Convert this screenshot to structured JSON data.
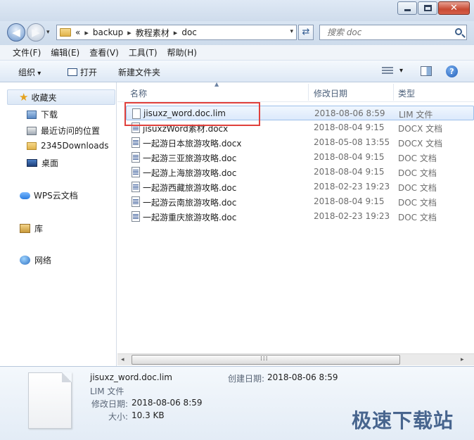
{
  "window": {
    "minimize_icon": "minimize-icon",
    "maximize_icon": "maximize-icon",
    "close_label": "✕"
  },
  "address": {
    "overflow": "«",
    "crumbs": [
      "backup",
      "教程素材",
      "doc"
    ],
    "separator": "▸",
    "refresh_glyph": "⇄",
    "search_placeholder": "搜索 doc"
  },
  "menu": [
    "文件(F)",
    "编辑(E)",
    "查看(V)",
    "工具(T)",
    "帮助(H)"
  ],
  "toolbar": {
    "organize": "组织",
    "open": "打开",
    "new_folder": "新建文件夹",
    "help_glyph": "?"
  },
  "sidebar": {
    "favorites": "收藏夹",
    "fav_items": [
      "下载",
      "最近访问的位置",
      "2345Downloads",
      "桌面"
    ],
    "wps_cloud": "WPS云文档",
    "library": "库",
    "network": "网络"
  },
  "columns": {
    "name": "名称",
    "date": "修改日期",
    "type": "类型"
  },
  "files": [
    {
      "name": "jisuxz_word.doc.lim",
      "date": "2018-08-06 8:59",
      "type": "LIM 文件",
      "icon": "blank-file-icon",
      "selected": true
    },
    {
      "name": "jisuxzWord素材.docx",
      "date": "2018-08-04 9:15",
      "type": "DOCX 文档",
      "icon": "word-doc-icon"
    },
    {
      "name": "一起游日本旅游攻略.docx",
      "date": "2018-05-08 13:55",
      "type": "DOCX 文档",
      "icon": "word-doc-icon"
    },
    {
      "name": "一起游三亚旅游攻略.doc",
      "date": "2018-08-04 9:15",
      "type": "DOC 文档",
      "icon": "word-doc-icon"
    },
    {
      "name": "一起游上海旅游攻略.doc",
      "date": "2018-08-04 9:15",
      "type": "DOC 文档",
      "icon": "word-doc-icon"
    },
    {
      "name": "一起游西藏旅游攻略.doc",
      "date": "2018-02-23 19:23",
      "type": "DOC 文档",
      "icon": "word-doc-icon"
    },
    {
      "name": "一起游云南旅游攻略.doc",
      "date": "2018-08-04 9:15",
      "type": "DOC 文档",
      "icon": "word-doc-icon"
    },
    {
      "name": "一起游重庆旅游攻略.doc",
      "date": "2018-02-23 19:23",
      "type": "DOC 文档",
      "icon": "word-doc-icon"
    }
  ],
  "scroll": {
    "left_arrow": "◂",
    "right_arrow": "▸",
    "grip": "⁞⁞⁞"
  },
  "details": {
    "filename": "jisuxz_word.doc.lim",
    "filetype": "LIM 文件",
    "modified_label": "修改日期:",
    "modified_value": "2018-08-06 8:59",
    "size_label": "大小:",
    "size_value": "10.3 KB",
    "created_label": "创建日期:",
    "created_value": "2018-08-06 8:59"
  },
  "watermark": "极速下载站",
  "colors": {
    "highlight_box": "#e0403c",
    "selection": "#dbe9fb"
  }
}
